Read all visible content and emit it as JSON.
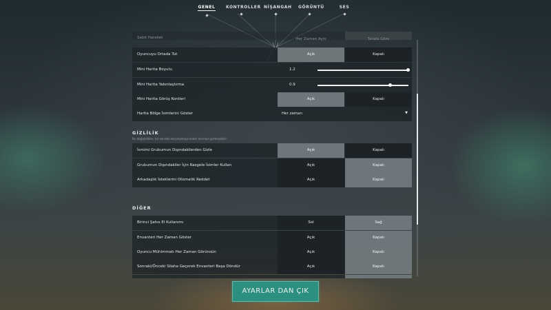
{
  "nav": {
    "tabs": [
      "GENEL",
      "KONTROLLER",
      "NİŞANGAH",
      "GÖRÜNTÜ",
      "SES"
    ],
    "active": "GENEL"
  },
  "rows_top": {
    "header": {
      "label": "Sabit Hareket",
      "opt_a": "Her Zaman Aynı",
      "opt_b": "Tarafa Göre"
    },
    "center_player": {
      "label": "Oyuncuyu Ortada Tut",
      "opt_a": "Açık",
      "opt_b": "Kapalı",
      "selected": "a"
    },
    "minimap_size": {
      "label": "Mini Harita Boyutu",
      "value": "1.2",
      "fraction": 1.0
    },
    "minimap_zoom": {
      "label": "Mini Harita Yakınlaştırma",
      "value": "0.9",
      "fraction": 0.8
    },
    "minimap_cones": {
      "label": "Mini Harita Görüş Konileri",
      "opt_a": "Açık",
      "opt_b": "Kapalı",
      "selected": "a"
    },
    "region_names": {
      "label": "Harita Bölge İsimlerini Göster",
      "value": "Her zaman"
    }
  },
  "privacy": {
    "title": "GİZLİLİK",
    "desc": "Bu değişiklikler, bir sonraki karşılaşmaya kadar devreye girmeyebilir",
    "rows": [
      {
        "label": "İsmimi Grubumun Dışındakilerden Gizle",
        "opt_a": "Açık",
        "opt_b": "Kapalı",
        "selected": "a"
      },
      {
        "label": "Grubumun Dışındakiler İçin Rasgele İsimler Kullan",
        "opt_a": "Açık",
        "opt_b": "Kapalı",
        "selected": "b"
      },
      {
        "label": "Arkadaşlık İsteklerini Otomatik Reddet",
        "opt_a": "Açık",
        "opt_b": "Kapalı",
        "selected": "b"
      }
    ]
  },
  "other": {
    "title": "DİĞER",
    "rows": [
      {
        "label": "Birinci Şahıs El Kullanımı",
        "opt_a": "Sol",
        "opt_b": "Sağ",
        "selected": "b"
      },
      {
        "label": "Envanteri Her Zaman Göster",
        "opt_a": "Açık",
        "opt_b": "Kapalı",
        "selected": "b"
      },
      {
        "label": "Oyuncu Mühimmatı Her Zaman Görünsün",
        "opt_a": "Açık",
        "opt_b": "Kapalı",
        "selected": "b"
      },
      {
        "label": "Sonraki/Önceki Silaha Geçerek Envanteri Başa Döndür",
        "opt_a": "Açık",
        "opt_b": "Kapalı",
        "selected": "b"
      }
    ]
  },
  "exit_button": "AYARLAR DAN ÇIK",
  "icons": {
    "dropdown": "chevron-down-icon"
  }
}
